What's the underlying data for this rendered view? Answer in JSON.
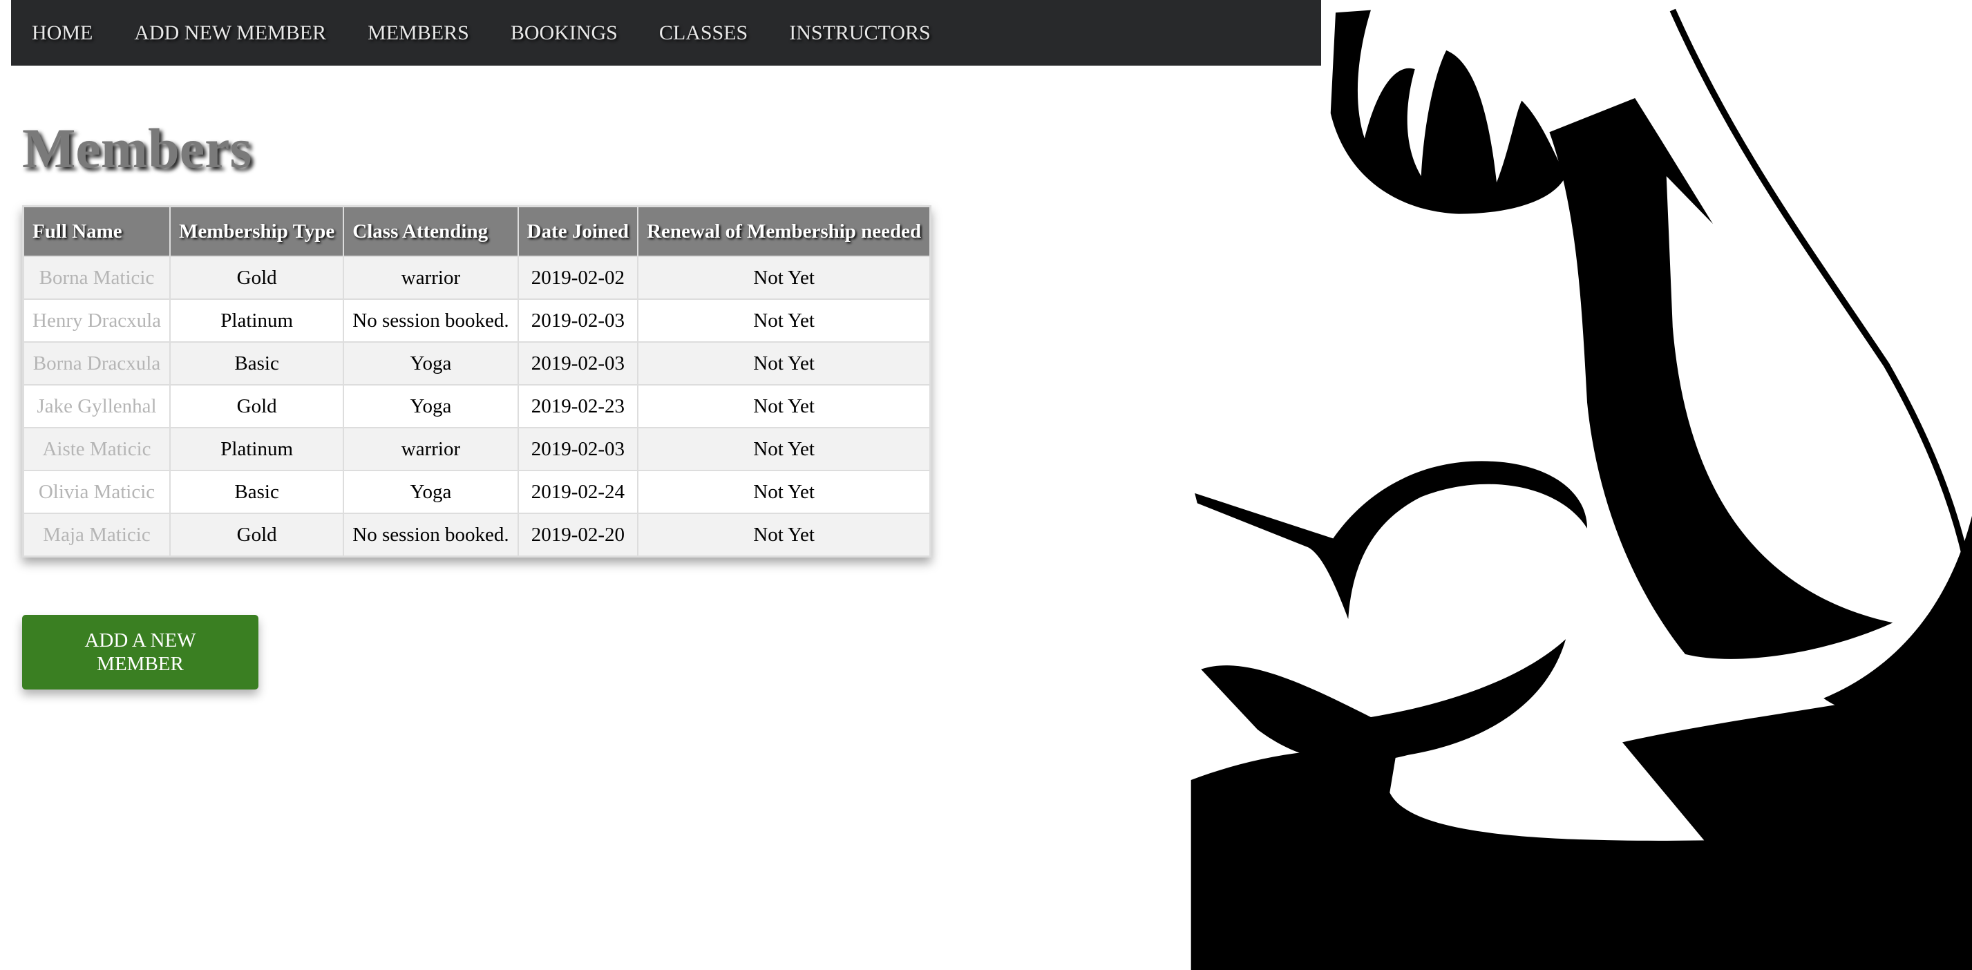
{
  "nav": {
    "items": [
      "HOME",
      "ADD NEW MEMBER",
      "MEMBERS",
      "BOOKINGS",
      "CLASSES",
      "INSTRUCTORS"
    ]
  },
  "page_title": "Members",
  "table": {
    "headers": [
      "Full Name",
      "Membership Type",
      "Class Attending",
      "Date Joined",
      "Renewal of Membership needed"
    ],
    "rows": [
      [
        "Borna Maticic",
        "Gold",
        "warrior",
        "2019-02-02",
        "Not Yet"
      ],
      [
        "Henry Dracxula",
        "Platinum",
        "No session booked.",
        "2019-02-03",
        "Not Yet"
      ],
      [
        "Borna Dracxula",
        "Basic",
        "Yoga",
        "2019-02-03",
        "Not Yet"
      ],
      [
        "Jake Gyllenhal",
        "Gold",
        "Yoga",
        "2019-02-23",
        "Not Yet"
      ],
      [
        "Aiste Maticic",
        "Platinum",
        "warrior",
        "2019-02-03",
        "Not Yet"
      ],
      [
        "Olivia Maticic",
        "Basic",
        "Yoga",
        "2019-02-24",
        "Not Yet"
      ],
      [
        "Maja Maticic",
        "Gold",
        "No session booked.",
        "2019-02-20",
        "Not Yet"
      ]
    ]
  },
  "add_button": "ADD A NEW MEMBER",
  "colors": {
    "nav_bg": "#28292b",
    "header_bg": "#808080",
    "button": "#3a7f22"
  }
}
